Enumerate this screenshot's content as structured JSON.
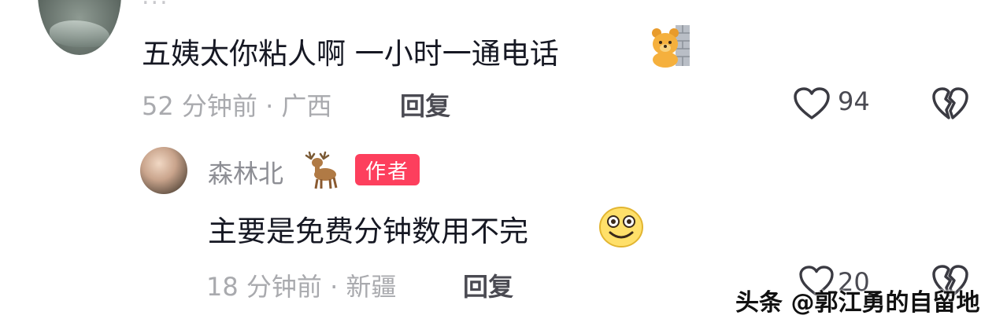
{
  "comment": {
    "username_partial": "...",
    "text": "五姨太你粘人啊 一小时一通电话",
    "time": "52 分钟前",
    "location_sep": "·",
    "location": "广西",
    "reply_label": "回复",
    "like_count": "94"
  },
  "reply": {
    "username": "森林北",
    "badge": "作者",
    "text": "主要是免费分钟数用不完",
    "time": "18 分钟前",
    "location_sep": "·",
    "location": "新疆",
    "reply_label": "回复",
    "like_count": "20"
  },
  "watermark": "头条 @郭江勇的自留地",
  "icons": {
    "like": "heart-outline-icon",
    "dislike": "broken-heart-icon",
    "bear": "bear-wall-emoji-icon",
    "deer": "deer-emoji-icon",
    "smile": "smile-emoji-icon"
  },
  "colors": {
    "badge": "#fd3f5d",
    "text": "#161823",
    "meta": "#a9aaae"
  }
}
